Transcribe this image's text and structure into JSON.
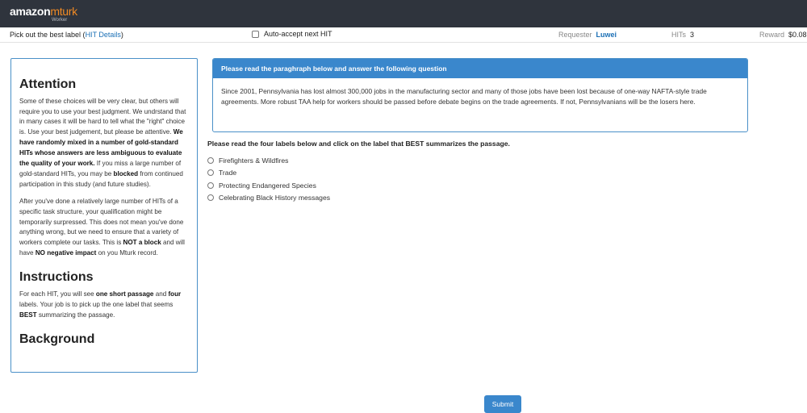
{
  "header": {
    "logo_amazon": "amazon",
    "logo_mturk": "mturk",
    "logo_sub": "Worker"
  },
  "hit_bar": {
    "title_prefix": "Pick out the best label (",
    "details_link": "HIT Details",
    "title_suffix": ")",
    "auto_accept_label": "Auto-accept next HIT",
    "requester_label": "Requester",
    "requester_name": "Luwei",
    "hits_label": "HITs",
    "hits_value": "3",
    "reward_label": "Reward",
    "reward_value": "$0.08"
  },
  "sidebar": {
    "attention_heading": "Attention",
    "p1": [
      "Some of these choices will be very clear, but others will require you to use your best judgment. We undrstand that in many cases it will be hard to tell what the \"right\" choice is. Use your best judgement, but please be attentive. ",
      "We have randomly mixed in a number of gold-standard HITs whose answers are less ambiguous to evaluate the quality of your work.",
      " If you miss a large number of gold-standard HITs, you may be ",
      "blocked",
      " from continued participation in this study (and future studies)."
    ],
    "p2": [
      "After you've done a relatively large number of HITs of a specific task structure, your qualification might be temporarily surpressed. This does not mean you've done anything wrong, but we need to ensure that a variety of workers complete our tasks. This is ",
      "NOT a block",
      " and will have ",
      "NO negative impact",
      " on you Mturk record."
    ],
    "instructions_heading": "Instructions",
    "p3": [
      "For each HIT, you will see ",
      "one short passage",
      " and ",
      "four",
      " labels. Your job is to pick up the one label that seems ",
      "BEST",
      " summarizing the passage."
    ],
    "background_heading": "Background"
  },
  "panel": {
    "heading": "Please read the paraghraph below and answer the following question",
    "passage": "Since 2001, Pennsylvania has lost almost 300,000 jobs in the manufacturing sector and many of those jobs have been lost because of one-way NAFTA-style trade agreements. More robust TAA help for workers should be passed before debate begins on the trade agreements. If not, Pennsylvanians will be the losers here."
  },
  "question": {
    "prompt": "Please read the four labels below and click on the label that BEST summarizes the passage.",
    "options": [
      "Firefighters & Wildfires",
      "Trade",
      "Protecting Endangered Species",
      "Celebrating Black History messages"
    ]
  },
  "submit_label": "Submit"
}
